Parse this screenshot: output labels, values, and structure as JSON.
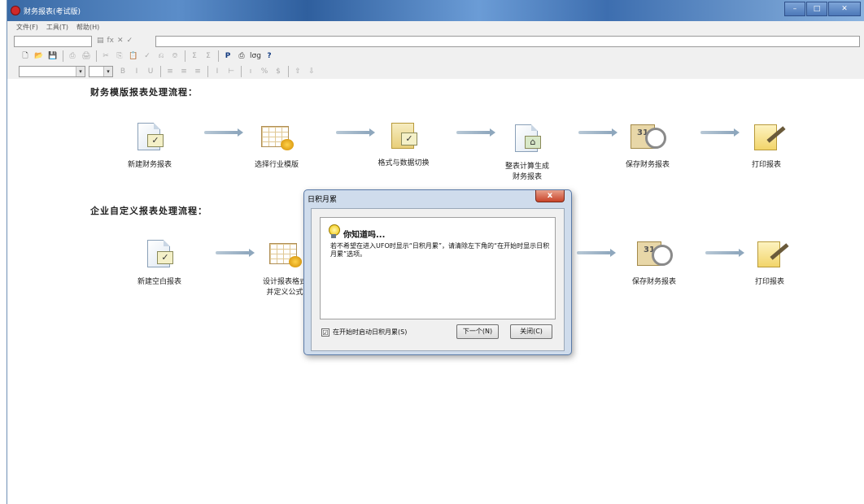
{
  "window": {
    "title": "财务报表(考试版)"
  },
  "menu": [
    "文件(F)",
    "工具(T)",
    "帮助(H)"
  ],
  "formula_bar": {
    "icons": [
      "▤",
      "fx",
      "✕",
      "✓"
    ]
  },
  "toolbar1": [
    "🗋",
    "📂",
    "💾",
    "⎙",
    "🖨",
    "✂",
    "⎘",
    "📋",
    "✓",
    "⎌",
    "⎊",
    "Σ",
    "Σ",
    "P",
    "⎙",
    "lσg",
    "?"
  ],
  "toolbar2": [
    "B",
    "I",
    "U",
    "≡",
    "≡",
    "≡",
    "I",
    "⊢",
    "ı",
    "%",
    "$",
    "⇧",
    "⇩"
  ],
  "section1": {
    "title": "财务模版报表处理流程：",
    "steps": [
      "新建财务报表",
      "选择行业模版",
      "格式与数据切换",
      "整表计算生成\n财务报表",
      "保存财务报表",
      "打印报表"
    ]
  },
  "section2": {
    "title": "企业自定义报表处理流程：",
    "steps": [
      "新建空白报表",
      "设计报表格式\n并定义公式",
      "保存财务报表",
      "打印报表"
    ]
  },
  "dialog": {
    "title": "日积月累",
    "close": "x",
    "tip_title": "你知道吗...",
    "tip_text": "若不希望在进入UFO时显示“日积月累”，请清除左下角的“在开始时显示日积月累”选项。",
    "checkbox_label": "在开始时启动日积月累(S)",
    "checkbox_checked": "☑",
    "next_label": "下一个(N)",
    "close_label": "关闭(C)"
  }
}
